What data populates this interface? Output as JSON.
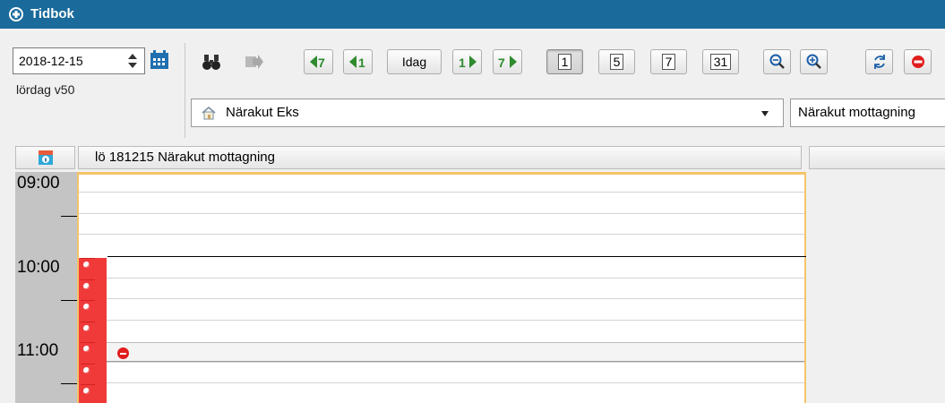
{
  "window": {
    "title": "Tidbok"
  },
  "datepicker": {
    "date": "2018-12-15",
    "weekday_week": "lördag v50"
  },
  "toolbar": {
    "today_label": "Idag",
    "view_1": "1",
    "view_5": "5",
    "view_7": "7",
    "view_31": "31"
  },
  "location": {
    "unit": "Närakut Eks",
    "reception": "Närakut mottagning"
  },
  "calendar": {
    "column_header": "lö 181215 Närakut mottagning",
    "hours": [
      "09:00",
      "10:00",
      "11:00"
    ],
    "selected_view": "1"
  },
  "colors": {
    "titlebar": "#1a6b9b",
    "blocked": "#f03a3a",
    "column_border": "#f5c46a",
    "time_column": "#c4c4c4"
  }
}
